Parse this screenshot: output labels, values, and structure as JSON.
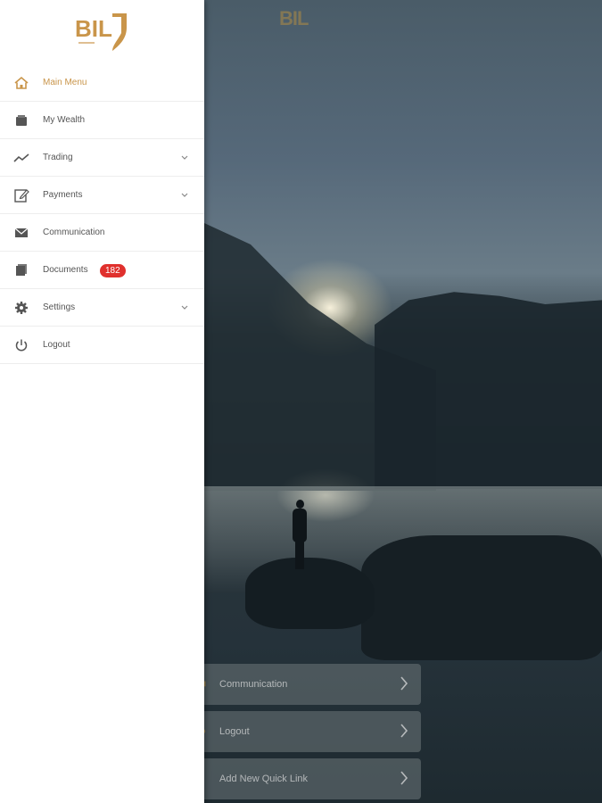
{
  "brand": {
    "logo_text": "BIL",
    "accent_color": "#c9954a"
  },
  "menu": {
    "items": [
      {
        "label": "Main Menu",
        "icon": "home-icon",
        "active": true
      },
      {
        "label": "My Wealth",
        "icon": "wallet-icon"
      },
      {
        "label": "Trading",
        "icon": "trend-line-icon",
        "expandable": true
      },
      {
        "label": "Payments",
        "icon": "edit-icon",
        "expandable": true
      },
      {
        "label": "Communication",
        "icon": "envelope-icon"
      },
      {
        "label": "Documents",
        "icon": "documents-icon",
        "badge": "182"
      },
      {
        "label": "Settings",
        "icon": "gear-icon",
        "expandable": true
      },
      {
        "label": "Logout",
        "icon": "power-icon"
      }
    ]
  },
  "quick_links": [
    {
      "label": "Communication",
      "icon": "communication-icon"
    },
    {
      "label": "Logout",
      "icon": "power-icon"
    },
    {
      "label": "Add New Quick Link",
      "icon": "add-icon"
    }
  ],
  "colors": {
    "badge": "#e0302d",
    "drawer_bg": "#ffffff"
  }
}
